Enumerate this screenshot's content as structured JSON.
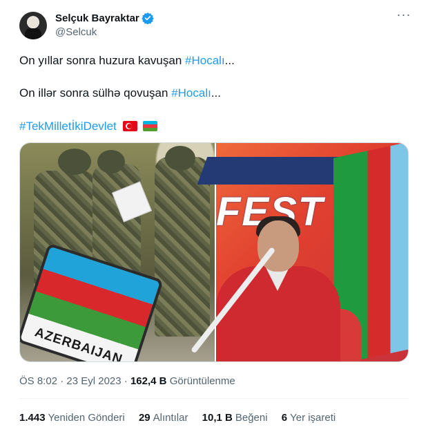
{
  "author": {
    "name": "Selçuk Bayraktar",
    "handle": "@Selcuk",
    "verified": true
  },
  "tweet": {
    "line1_text": "On yıllar sonra huzura kavuşan ",
    "line1_hashtag": "#Hocalı",
    "line1_suffix": "...",
    "line2_text": "On illər sonra sülhə qovuşan ",
    "line2_hashtag": "#Hocalı",
    "line2_suffix": "...",
    "line3_hashtag": "#TekMilletİkiDevlet"
  },
  "media": {
    "left_photo_patch_text": "AZERBAIJAN",
    "right_photo_banner_text": "FEST"
  },
  "meta": {
    "time": "ÖS 8:02",
    "separator": " · ",
    "date": "23 Eyl 2023",
    "views_count": "162,4 B",
    "views_label": "Görüntülenme"
  },
  "stats": [
    {
      "count": "1.443",
      "label": "Yeniden Gönderi"
    },
    {
      "count": "29",
      "label": "Alıntılar"
    },
    {
      "count": "10,1 B",
      "label": "Beğeni"
    },
    {
      "count": "6",
      "label": "Yer işareti"
    }
  ],
  "colors": {
    "accent": "#1d9bf0",
    "secondary_text": "#536471",
    "primary_text": "#0f1419"
  },
  "icons": {
    "verified": "verified-badge-icon",
    "more": "more-options-icon",
    "flags": [
      "turkey-flag-icon",
      "azerbaijan-flag-icon"
    ]
  }
}
